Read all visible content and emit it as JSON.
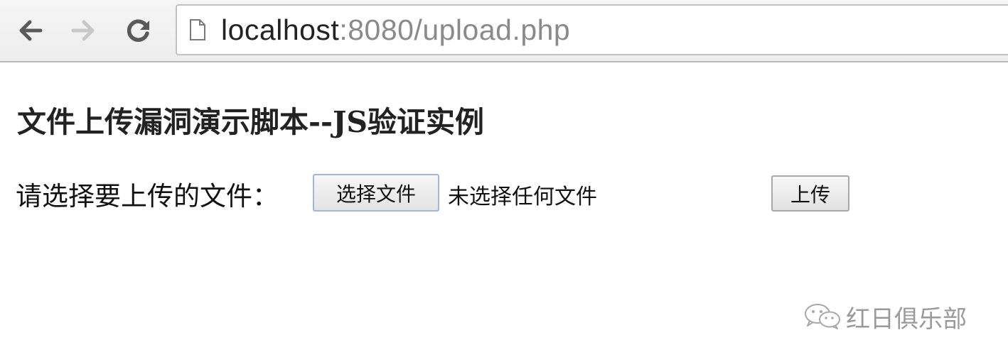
{
  "browser": {
    "back_icon": "arrow-left-icon",
    "forward_icon": "arrow-right-icon",
    "reload_icon": "reload-icon",
    "page_icon": "document-icon",
    "url_host": "localhost",
    "url_rest": ":8080/upload.php"
  },
  "page": {
    "title": "文件上传漏洞演示脚本--JS验证实例",
    "form": {
      "label": "请选择要上传的文件：",
      "choose_button": "选择文件",
      "no_file_text": "未选择任何文件",
      "submit_button": "上传"
    }
  },
  "watermark": {
    "icon": "wechat-icon",
    "text": "红日俱乐部"
  },
  "colors": {
    "toolbar_bg": "#f0f0f0",
    "url_muted": "#8a8a8a",
    "watermark": "#9a9a9a"
  }
}
